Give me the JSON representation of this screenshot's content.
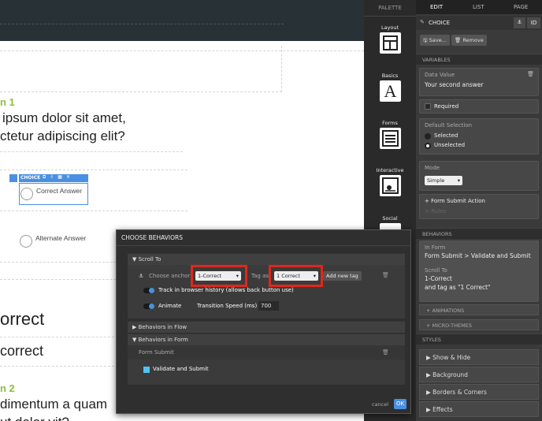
{
  "canvas": {
    "q1_number": "n 1",
    "q1_line1": "ipsum dolor sit amet,",
    "q1_line2": "ctetur adipiscing elit?",
    "choice_toolbar_label": "CHOICE",
    "choice_correct": "Correct Answer",
    "choice_alternate": "Alternate Answer",
    "correct_text": "orrect",
    "incorrect_text": "correct",
    "q2_number": "n 2",
    "q2_line1": "dimentum a quam",
    "q2_line2": "ut dolor vit?"
  },
  "palette": {
    "tab": "PALETTE",
    "items": [
      "Layout",
      "Basics",
      "Forms",
      "Interactive",
      "Social"
    ]
  },
  "edit": {
    "tabs": [
      "EDIT",
      "LIST",
      "PAGE"
    ],
    "title": "CHOICE",
    "save_label": "Save...",
    "remove_label": "Remove",
    "variables_header": "VARIABLES",
    "data_value_label": "Data Value",
    "data_value": "Your second answer",
    "required_label": "Required",
    "default_selection_label": "Default Selection",
    "selected_label": "Selected",
    "unselected_label": "Unselected",
    "mode_label": "Mode",
    "mode_value": "Simple",
    "form_submit_action": "+ Form Submit Action",
    "rules_label": "+ Rules",
    "behaviors_header": "BEHAVIORS",
    "in_form_label": "In Form",
    "in_form_value": "Form Submit > Validate and Submit",
    "scroll_to_label": "Scroll To",
    "scroll_to_value": "1-Correct",
    "scroll_tag_value": "and tag as \"1 Correct\"",
    "animations": "+ ANIMATIONS",
    "micro_themes": "+ MICRO-THEMES",
    "styles_header": "STYLES",
    "styles": [
      "Show & Hide",
      "Background",
      "Borders & Corners",
      "Effects"
    ]
  },
  "modal": {
    "title": "CHOOSE BEHAVIORS",
    "scroll_to_header": "Scroll To",
    "choose_anchor_label": "Choose anchor",
    "anchor_value": "1-Correct",
    "tag_as_label": "Tag as",
    "tag_value": "1 Correct",
    "add_new_tag": "Add new tag",
    "track_history_label": "Track in browser history (allows back button use)",
    "animate_label": "Animate",
    "transition_label": "Transition Speed (ms)",
    "transition_value": "700",
    "behaviors_in_flow": "Behaviors in Flow",
    "behaviors_in_form": "Behaviors in Form",
    "form_submit": "Form Submit",
    "validate_and_submit": "Validate and Submit",
    "cancel_label": "cancel",
    "ok_label": "OK"
  },
  "colors": {
    "accent": "#4a90e2",
    "highlight": "#e0261c",
    "question_number": "#8ebf3b"
  }
}
